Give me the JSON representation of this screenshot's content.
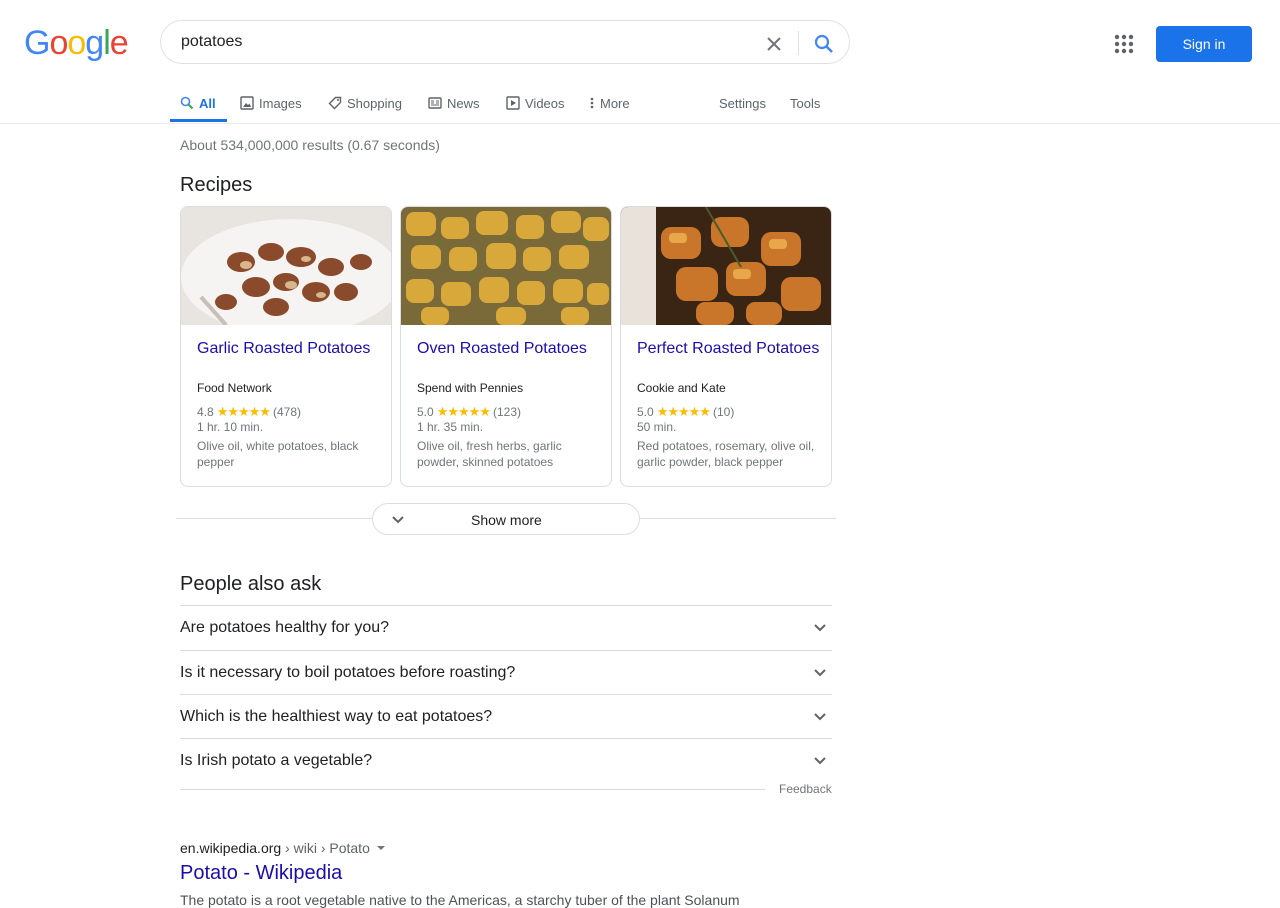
{
  "header": {
    "logo_letters": [
      "G",
      "o",
      "o",
      "g",
      "l",
      "e"
    ],
    "logo_colors": [
      "#4285f4",
      "#ea4335",
      "#fbbc05",
      "#4285f4",
      "#34a853",
      "#ea4335"
    ],
    "search_value": "potatoes",
    "signin_label": "Sign in"
  },
  "tabs": [
    {
      "label": "All",
      "icon": "search-icon",
      "active": true
    },
    {
      "label": "Images",
      "icon": "image-icon",
      "active": false
    },
    {
      "label": "Shopping",
      "icon": "tag-icon",
      "active": false
    },
    {
      "label": "News",
      "icon": "newspaper-icon",
      "active": false
    },
    {
      "label": "Videos",
      "icon": "play-icon",
      "active": false
    },
    {
      "label": "More",
      "icon": "more-vert-icon",
      "active": false
    }
  ],
  "tools": {
    "settings": "Settings",
    "tools": "Tools"
  },
  "stats": "About 534,000,000 results (0.67 seconds)",
  "recipes": {
    "title": "Recipes",
    "cards": [
      {
        "title": "Garlic Roasted Potatoes",
        "source": "Food Network",
        "rating": "4.8",
        "stars": "★★★★★",
        "count": "(478)",
        "time": "1 hr. 10 min.",
        "ingredients": "Olive oil, white potatoes, black pepper"
      },
      {
        "title": "Oven Roasted Potatoes",
        "source": "Spend with Pennies",
        "rating": "5.0",
        "stars": "★★★★★",
        "count": "(123)",
        "time": "1 hr. 35 min.",
        "ingredients": "Olive oil, fresh herbs, garlic powder, skinned potatoes"
      },
      {
        "title": "Perfect Roasted Potatoes",
        "source": "Cookie and Kate",
        "rating": "5.0",
        "stars": "★★★★★",
        "count": "(10)",
        "time": "50 min.",
        "ingredients": "Red potatoes, rosemary, olive oil, garlic powder, black pepper"
      }
    ],
    "show_more": "Show more"
  },
  "paa": {
    "title": "People also ask",
    "questions": [
      "Are potatoes healthy for you?",
      "Is it necessary to boil potatoes before roasting?",
      "Which is the healthiest way to eat potatoes?",
      "Is Irish potato a vegetable?"
    ],
    "feedback": "Feedback"
  },
  "result": {
    "domain": "en.wikipedia.org",
    "path": " › wiki › Potato",
    "title": "Potato - Wikipedia",
    "snippet": "The potato is a root vegetable native to the Americas, a starchy tuber of the plant Solanum"
  },
  "colors": {
    "accent": "#1a73e8",
    "link": "#1a0dab",
    "star": "#fbbc04"
  }
}
